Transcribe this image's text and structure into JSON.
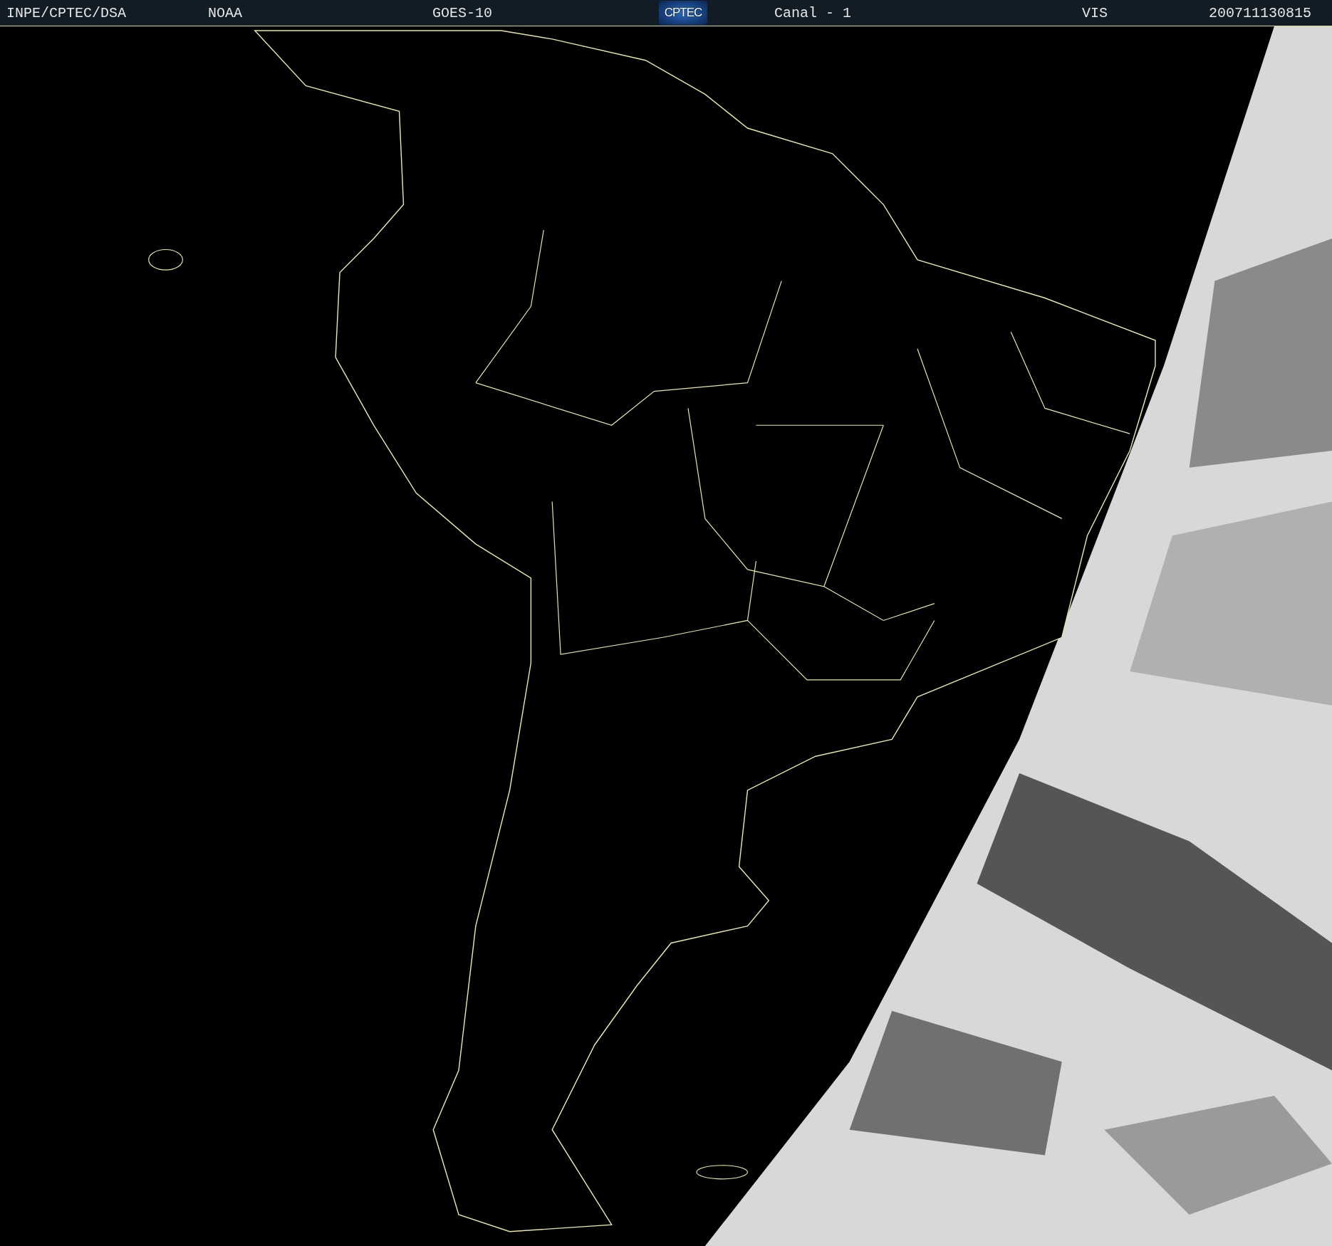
{
  "header": {
    "items": [
      {
        "kind": "text",
        "text": "INPE/CPTEC/DSA"
      },
      {
        "kind": "text",
        "text": "NOAA"
      },
      {
        "kind": "text",
        "text": "GOES-10"
      },
      {
        "kind": "logo",
        "text": "CPTEC"
      },
      {
        "kind": "text",
        "text": "Canal - 1"
      },
      {
        "kind": "text",
        "text": "VIS"
      },
      {
        "kind": "text",
        "text": "200711130815"
      }
    ]
  }
}
